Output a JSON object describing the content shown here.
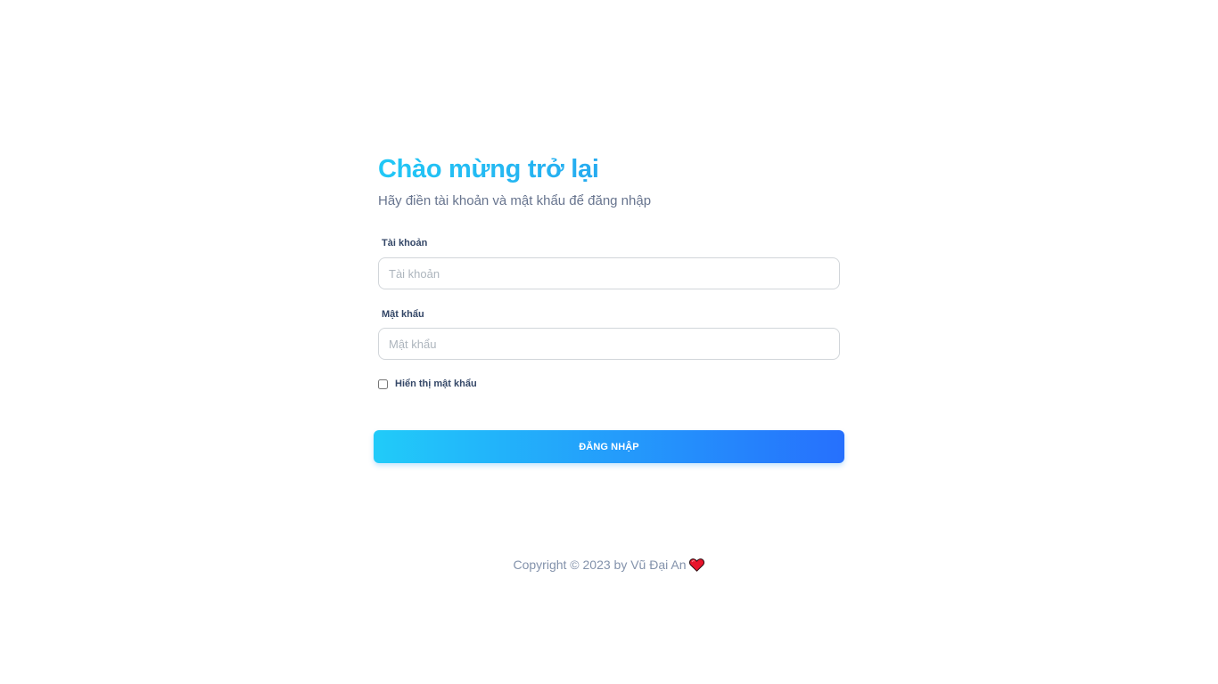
{
  "login": {
    "title": "Chào mừng trở lại",
    "subtitle": "Hãy điền tài khoản và mật khẩu để đăng nhập",
    "username": {
      "label": "Tài khoản",
      "placeholder": "Tài khoản",
      "value": ""
    },
    "password": {
      "label": "Mật khẩu",
      "placeholder": "Mật khẩu",
      "value": ""
    },
    "show_password": {
      "label": "Hiển thị mật khẩu",
      "checked": false
    },
    "submit_label": "ĐĂNG NHẬP"
  },
  "footer": {
    "text": "Copyright © 2023 by Vũ Đại An",
    "icon": "heart-icon"
  },
  "colors": {
    "accent_start": "#21cbf9",
    "accent_end": "#2670fd",
    "heart": "#e8142b"
  }
}
